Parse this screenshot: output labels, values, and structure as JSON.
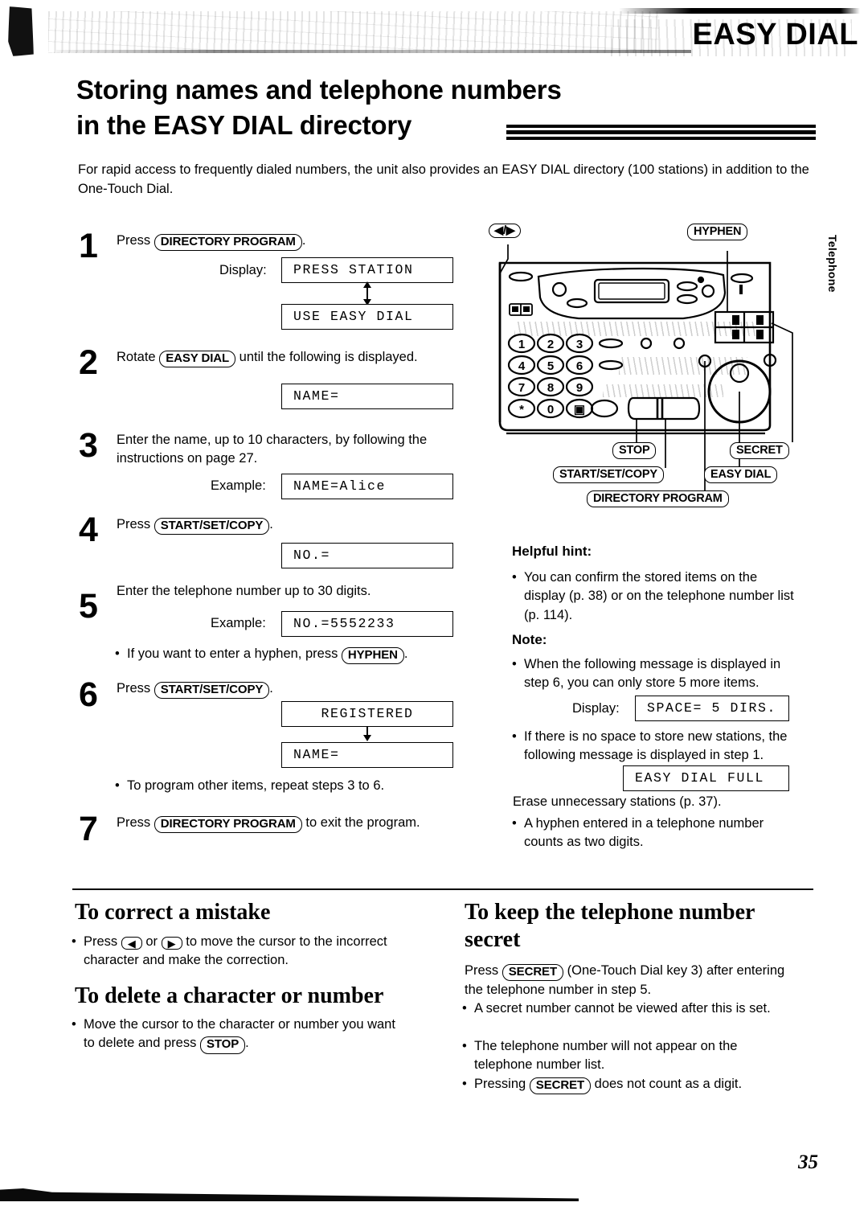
{
  "header": {
    "tab_label": "EASY DIAL",
    "side_tab_label": "Telephone"
  },
  "title": {
    "line1": "Storing names and telephone numbers",
    "line2": "in the EASY DIAL directory"
  },
  "intro": "For rapid access to frequently dialed numbers, the unit also provides an EASY DIAL directory (100 stations) in addition to the One-Touch Dial.",
  "steps": [
    {
      "num": "1",
      "text_before": "Press",
      "key": "DIRECTORY PROGRAM",
      "text_after": ".",
      "display_label": "Display:",
      "lcd1": "PRESS STATION",
      "lcd2": "USE EASY DIAL"
    },
    {
      "num": "2",
      "text_before": "Rotate",
      "key": "EASY DIAL",
      "text_after": "until the following is displayed.",
      "lcd1": "NAME="
    },
    {
      "num": "3",
      "text": "Enter the name, up to 10 characters, by following the instructions on page 27.",
      "example_label": "Example:",
      "lcd1": "NAME=Alice"
    },
    {
      "num": "4",
      "text_before": "Press",
      "key": "START/SET/COPY",
      "text_after": ".",
      "lcd1": "NO.="
    },
    {
      "num": "5",
      "text": "Enter the telephone number up to 30 digits.",
      "example_label": "Example:",
      "lcd1": "NO.=5552233",
      "bullet_before": "If you want to enter a hyphen, press",
      "bullet_key": "HYPHEN",
      "bullet_after": "."
    },
    {
      "num": "6",
      "text_before": "Press",
      "key": "START/SET/COPY",
      "text_after": ".",
      "lcd1": "REGISTERED",
      "lcd2": "NAME=",
      "bullet": "To program other items, repeat steps 3 to 6."
    },
    {
      "num": "7",
      "text_before": "Press",
      "key": "DIRECTORY PROGRAM",
      "text_after": "to exit the program."
    }
  ],
  "device_callouts": {
    "cursor_keys": "/",
    "hyphen": "HYPHEN",
    "stop": "STOP",
    "secret": "SECRET",
    "start_set_copy": "START/SET/COPY",
    "easy_dial": "EASY DIAL",
    "directory_program": "DIRECTORY PROGRAM",
    "keypad": [
      "1",
      "2",
      "3",
      "4",
      "5",
      "6",
      "7",
      "8",
      "9",
      "∗",
      "0",
      "▣"
    ]
  },
  "helpful_hint": {
    "heading": "Helpful hint:",
    "bullet1": "You can confirm the stored items on the display (p. 38) or on the telephone number list (p. 114)."
  },
  "note": {
    "heading": "Note:",
    "bullet1": "When the following message is displayed in step 6, you can only store 5 more items.",
    "display_label": "Display:",
    "lcd1": "SPACE= 5 DIRS.",
    "bullet2": "If there is no space to store new stations, the following message is displayed in step 1.",
    "lcd2": "EASY DIAL FULL",
    "after_lcd2": "Erase unnecessary stations (p. 37).",
    "bullet3": "A hyphen entered in a telephone number counts as two digits."
  },
  "correct_mistake": {
    "heading": "To correct a mistake",
    "bullet_a": "Press",
    "bullet_or": "or",
    "bullet_b": "to move the cursor to the incorrect character and make the correction."
  },
  "delete_char": {
    "heading": "To delete a character or number",
    "bullet_before": "Move the cursor to the character or number you want to delete and press",
    "bullet_key": "STOP",
    "bullet_after": "."
  },
  "keep_secret": {
    "heading_line1": "To keep the telephone number",
    "heading_line2": "secret",
    "intro_before": "Press",
    "intro_key": "SECRET",
    "intro_after": "(One-Touch Dial key 3) after entering the telephone number in step 5.",
    "bullet1": "A secret number cannot be viewed after this is set.",
    "bullet2": "The telephone number will not appear on the telephone number list.",
    "bullet3_before": "Pressing",
    "bullet3_key": "SECRET",
    "bullet3_after": "does not count as a digit."
  },
  "page_number": "35"
}
